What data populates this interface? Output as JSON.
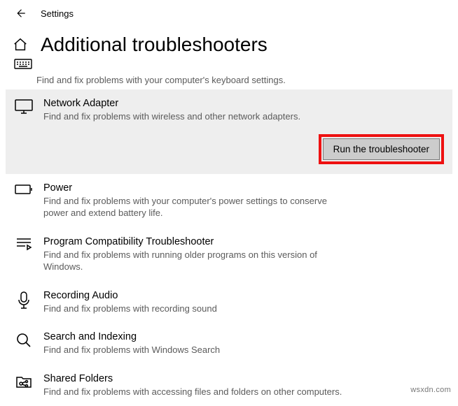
{
  "header": {
    "label": "Settings"
  },
  "page": {
    "title": "Additional troubleshooters"
  },
  "keyboard_partial": {
    "desc": "Find and fix problems with your computer's keyboard settings."
  },
  "selected": {
    "title": "Network Adapter",
    "desc": "Find and fix problems with wireless and other network adapters.",
    "button": "Run the troubleshooter"
  },
  "items": [
    {
      "title": "Power",
      "desc": "Find and fix problems with your computer's power settings to conserve power and extend battery life."
    },
    {
      "title": "Program Compatibility Troubleshooter",
      "desc": "Find and fix problems with running older programs on this version of Windows."
    },
    {
      "title": "Recording Audio",
      "desc": "Find and fix problems with recording sound"
    },
    {
      "title": "Search and Indexing",
      "desc": "Find and fix problems with Windows Search"
    },
    {
      "title": "Shared Folders",
      "desc": "Find and fix problems with accessing files and folders on other computers."
    }
  ],
  "watermark": "wsxdn.com"
}
